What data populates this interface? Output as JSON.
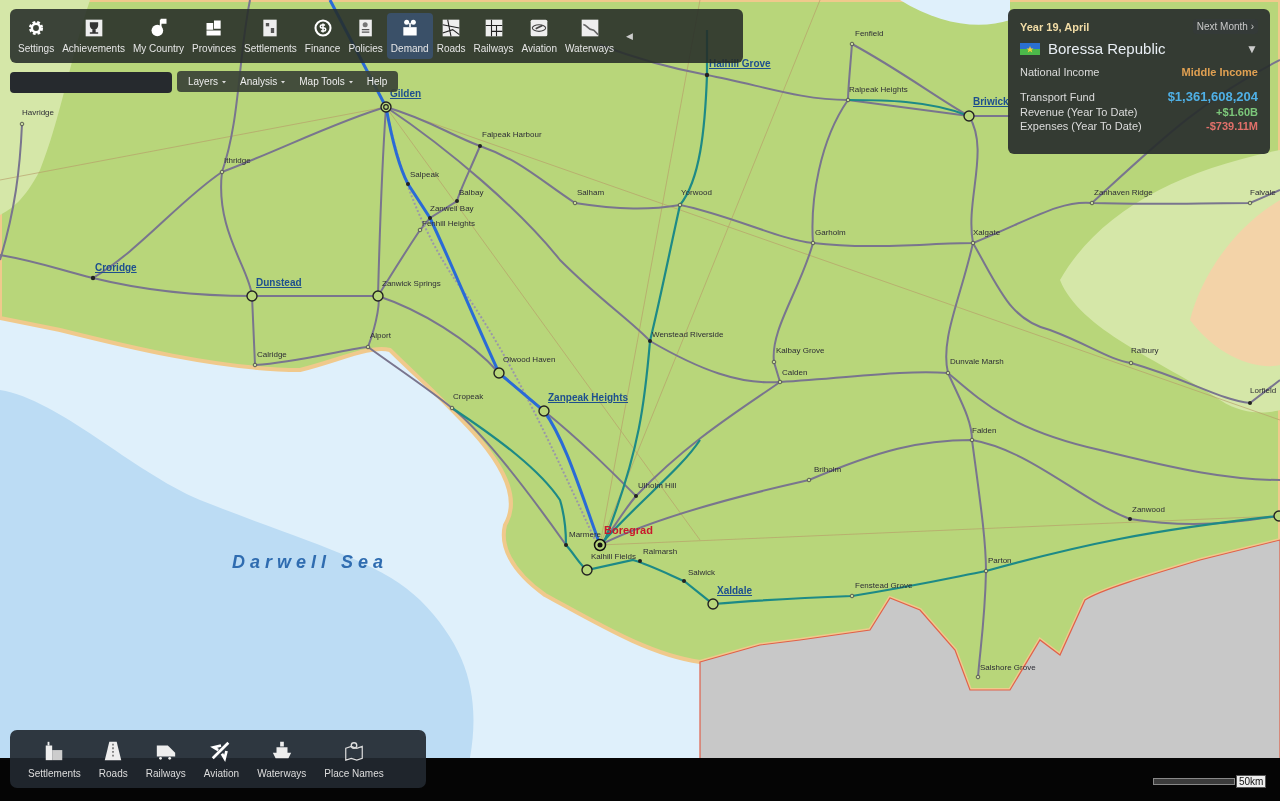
{
  "toolbar": {
    "items": [
      {
        "label": "Settings",
        "selected": false
      },
      {
        "label": "Achievements",
        "selected": false
      },
      {
        "label": "My Country",
        "selected": false
      },
      {
        "label": "Provinces",
        "selected": false
      },
      {
        "label": "Settlements",
        "selected": false
      },
      {
        "label": "Finance",
        "selected": false
      },
      {
        "label": "Policies",
        "selected": false
      },
      {
        "label": "Demand",
        "selected": true
      },
      {
        "label": "Roads",
        "selected": false
      },
      {
        "label": "Railways",
        "selected": false
      },
      {
        "label": "Aviation",
        "selected": false
      },
      {
        "label": "Waterways",
        "selected": false
      }
    ],
    "collapse": "◀"
  },
  "menu": [
    {
      "label": "Layers",
      "dropdown": true
    },
    {
      "label": "Analysis",
      "dropdown": true
    },
    {
      "label": "Map Tools",
      "dropdown": true
    },
    {
      "label": "Help",
      "dropdown": false
    }
  ],
  "panel": {
    "date": "Year 19, April",
    "next": "Next Month ›",
    "country": "Boressa Republic",
    "dropdown": "▼",
    "rows": [
      {
        "kind": "income",
        "label": "National Income",
        "value": "Middle Income",
        "color": "#e0a052"
      },
      {
        "kind": "fund",
        "label": "Transport Fund",
        "value": "$1,361,608,204",
        "color": "#4fb0e6"
      },
      {
        "kind": "stat",
        "label": "Revenue (Year To Date)",
        "value": "+$1.60B",
        "color": "#7cc77a"
      },
      {
        "kind": "stat",
        "label": "Expenses (Year To Date)",
        "value": "-$739.11M",
        "color": "#e0706a"
      }
    ]
  },
  "map": {
    "sea_label": "Darwell Sea",
    "places": [
      {
        "name": "Halhill Grove",
        "kind": "city"
      },
      {
        "name": "Fenfield",
        "kind": "town"
      },
      {
        "name": "Ralpeak Heights",
        "kind": "town"
      },
      {
        "name": "Briwick",
        "kind": "city"
      },
      {
        "name": "Havridge",
        "kind": "town"
      },
      {
        "name": "Gilden",
        "kind": "hub"
      },
      {
        "name": "Falpeak Harbour",
        "kind": "town"
      },
      {
        "name": "Ithridge",
        "kind": "town"
      },
      {
        "name": "Salpeak",
        "kind": "town"
      },
      {
        "name": "Balbay",
        "kind": "town"
      },
      {
        "name": "Salham",
        "kind": "town"
      },
      {
        "name": "Yorwood",
        "kind": "town"
      },
      {
        "name": "Zanwell Bay",
        "kind": "town"
      },
      {
        "name": "Fenhill Heights",
        "kind": "town"
      },
      {
        "name": "Garholm",
        "kind": "town"
      },
      {
        "name": "Xalgate",
        "kind": "town"
      },
      {
        "name": "Zanhaven Ridge",
        "kind": "town"
      },
      {
        "name": "Falvale",
        "kind": "town"
      },
      {
        "name": "Croridge",
        "kind": "city"
      },
      {
        "name": "Dunstead",
        "kind": "city"
      },
      {
        "name": "Zanwick Springs",
        "kind": "town"
      },
      {
        "name": "Alport",
        "kind": "town"
      },
      {
        "name": "Calridge",
        "kind": "town"
      },
      {
        "name": "Wenstead Riverside",
        "kind": "town"
      },
      {
        "name": "Kalbay Grove",
        "kind": "town"
      },
      {
        "name": "Calden",
        "kind": "town"
      },
      {
        "name": "Dunvale Marsh",
        "kind": "town"
      },
      {
        "name": "Ralbury",
        "kind": "town"
      },
      {
        "name": "Lorfield",
        "kind": "town"
      },
      {
        "name": "Olwood Haven",
        "kind": "town"
      },
      {
        "name": "Cropeak",
        "kind": "town"
      },
      {
        "name": "Zanpeak Heights",
        "kind": "city"
      },
      {
        "name": "Falden",
        "kind": "town"
      },
      {
        "name": "Ulholm Hill",
        "kind": "town"
      },
      {
        "name": "Briholm",
        "kind": "town"
      },
      {
        "name": "Zanwood",
        "kind": "town"
      },
      {
        "name": "Boregrad",
        "kind": "capital"
      },
      {
        "name": "Marmere",
        "kind": "town"
      },
      {
        "name": "Ralmarsh",
        "kind": "town"
      },
      {
        "name": "Kalhill Fields",
        "kind": "town"
      },
      {
        "name": "Salwick",
        "kind": "town"
      },
      {
        "name": "Xaldale",
        "kind": "city"
      },
      {
        "name": "Fenstead Grove",
        "kind": "town"
      },
      {
        "name": "Parton",
        "kind": "town"
      },
      {
        "name": "Salshore Grove",
        "kind": "town"
      }
    ]
  },
  "layers_bar": {
    "items": [
      {
        "label": "Settlements"
      },
      {
        "label": "Roads"
      },
      {
        "label": "Railways"
      },
      {
        "label": "Aviation"
      },
      {
        "label": "Waterways"
      },
      {
        "label": "Place Names"
      }
    ]
  },
  "scale": {
    "label": "50km"
  }
}
